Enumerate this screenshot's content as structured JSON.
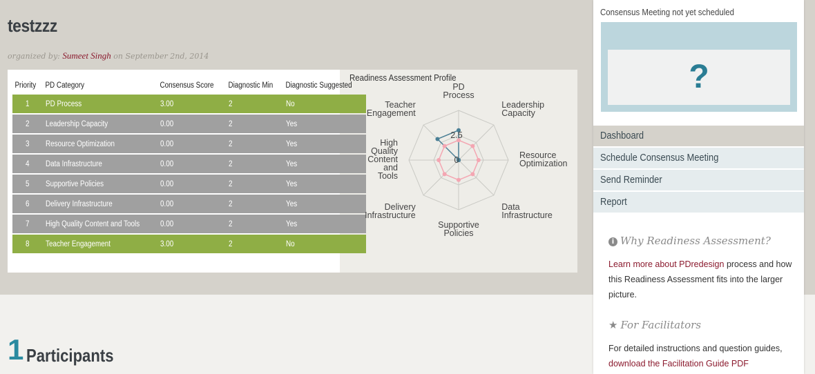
{
  "header": {
    "title": "testzzz",
    "organized_prefix": "organized by:",
    "organizer": "Sumeet Singh",
    "date_text": "on September 2nd, 2014"
  },
  "table": {
    "columns": [
      "Priority",
      "PD Category",
      "Consensus Score",
      "Diagnostic Min",
      "Diagnostic Suggested"
    ],
    "rows": [
      {
        "priority": "1",
        "category": "PD Process",
        "score": "3.00",
        "min": "2",
        "suggested": "No",
        "highlight": true
      },
      {
        "priority": "2",
        "category": "Leadership Capacity",
        "score": "0.00",
        "min": "2",
        "suggested": "Yes",
        "highlight": false
      },
      {
        "priority": "3",
        "category": "Resource Optimization",
        "score": "0.00",
        "min": "2",
        "suggested": "Yes",
        "highlight": false
      },
      {
        "priority": "4",
        "category": "Data Infrastructure",
        "score": "0.00",
        "min": "2",
        "suggested": "Yes",
        "highlight": false
      },
      {
        "priority": "5",
        "category": "Supportive Policies",
        "score": "0.00",
        "min": "2",
        "suggested": "Yes",
        "highlight": false
      },
      {
        "priority": "6",
        "category": "Delivery Infrastructure",
        "score": "0.00",
        "min": "2",
        "suggested": "Yes",
        "highlight": false
      },
      {
        "priority": "7",
        "category": "High Quality Content and Tools",
        "score": "0.00",
        "min": "2",
        "suggested": "Yes",
        "highlight": false
      },
      {
        "priority": "8",
        "category": "Teacher Engagement",
        "score": "3.00",
        "min": "2",
        "suggested": "No",
        "highlight": true
      }
    ],
    "colors": {
      "highlight": "#8fae45",
      "normal": "#a0a0a0"
    }
  },
  "chart_data": {
    "type": "radar",
    "title": "Readiness Assessment Profile",
    "axes": [
      [
        "PD",
        "Process"
      ],
      [
        "Leadership",
        "Capacity"
      ],
      [
        "Resource",
        "Optimization"
      ],
      [
        "Data",
        "Infrastructure"
      ],
      [
        "Supportive",
        "Policies"
      ],
      [
        "Delivery",
        "Infrastructure"
      ],
      [
        "High",
        "Quality",
        "Content",
        "and",
        "Tools"
      ],
      [
        "Teacher",
        "Engagement"
      ]
    ],
    "scale_labels": [
      "0",
      "2.5"
    ],
    "range": [
      0,
      5
    ],
    "series": [
      {
        "values": [
          3,
          0,
          0,
          0,
          0,
          0,
          0,
          3
        ],
        "color": "#4a7f95"
      },
      {
        "values": [
          2,
          2,
          2,
          2,
          2,
          2,
          2,
          2
        ],
        "color": "#f4a6b2"
      }
    ]
  },
  "participants": {
    "count": "1",
    "label": "Participants"
  },
  "sidebar": {
    "consensus_status": "Consensus Meeting not yet scheduled",
    "placeholder_symbol": "?",
    "nav": [
      "Dashboard",
      "Schedule Consensus Meeting",
      "Send Reminder",
      "Report"
    ],
    "why_title": "Why Readiness Assessment?",
    "why_link": "Learn more about PDredesign",
    "why_text": " process and how this Readiness Assessment fits into the larger picture.",
    "fac_title": "For Facilitators",
    "fac_text": "For detailed instructions and question guides,",
    "fac_link": "download the Facilitation Guide PDF"
  }
}
